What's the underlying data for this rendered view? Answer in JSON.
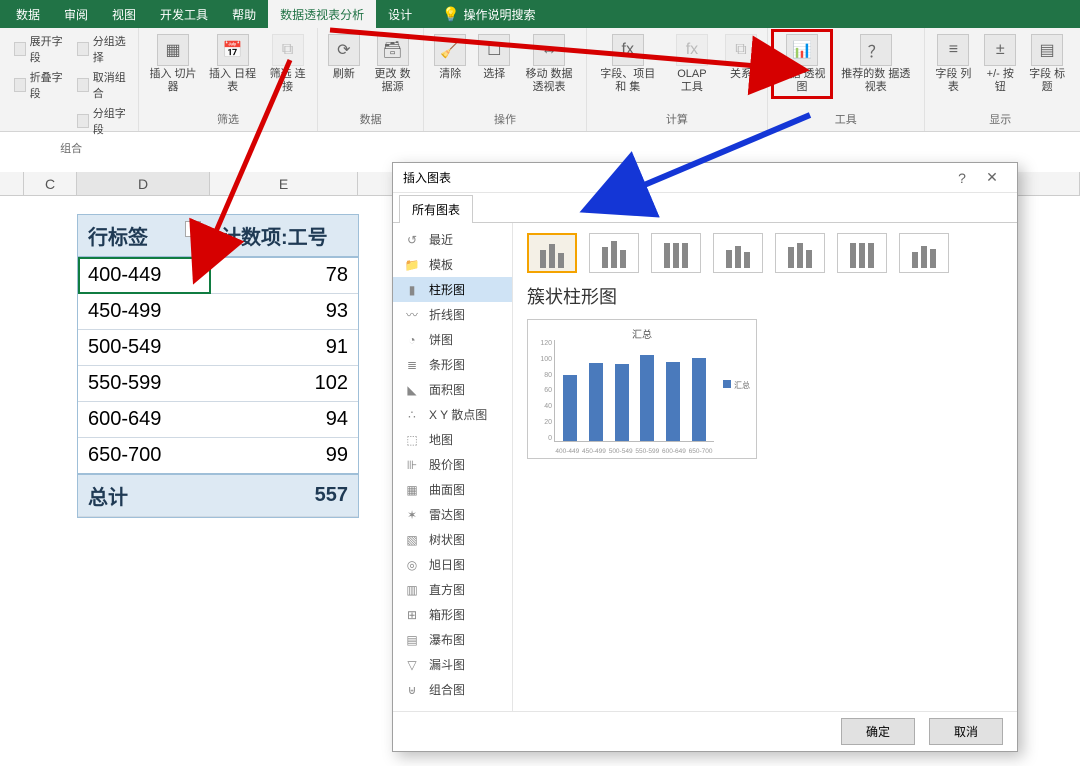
{
  "tabs": {
    "items": [
      "数据",
      "审阅",
      "视图",
      "开发工具",
      "帮助",
      "数据透视表分析",
      "设计"
    ],
    "active_index": 5,
    "tell_me": "操作说明搜索"
  },
  "ribbon": {
    "groups": [
      {
        "label": "组合",
        "small": [
          "分组选择",
          "取消组合",
          "分组字段"
        ],
        "left_small": [
          "展开字段",
          "折叠字段"
        ]
      },
      {
        "label": "筛选",
        "big": [
          {
            "label": "插入\n切片器"
          },
          {
            "label": "插入\n日程表"
          },
          {
            "label": "筛选\n连接",
            "disabled": true
          }
        ]
      },
      {
        "label": "数据",
        "big": [
          {
            "label": "刷新"
          },
          {
            "label": "更改\n数据源"
          }
        ]
      },
      {
        "label": "操作",
        "big": [
          {
            "label": "清除"
          },
          {
            "label": "选择"
          },
          {
            "label": "移动\n数据透视表"
          }
        ]
      },
      {
        "label": "计算",
        "big": [
          {
            "label": "字段、项目和\n集"
          },
          {
            "label": "OLAP 工具",
            "disabled": true
          },
          {
            "label": "关系",
            "disabled": true
          }
        ]
      },
      {
        "label": "工具",
        "big": [
          {
            "label": "数据\n透视图",
            "highlight": true
          },
          {
            "label": "推荐的数\n据透视表"
          }
        ]
      },
      {
        "label": "显示",
        "big": [
          {
            "label": "字段\n列表"
          },
          {
            "label": "+/- 按钮"
          },
          {
            "label": "字段\n标题"
          }
        ]
      }
    ]
  },
  "columns": [
    "C",
    "D",
    "E"
  ],
  "pivot": {
    "row_label": "行标签",
    "value_label": "计数项:工号",
    "rows": [
      {
        "label": "400-449",
        "value": 78
      },
      {
        "label": "450-499",
        "value": 93
      },
      {
        "label": "500-549",
        "value": 91
      },
      {
        "label": "550-599",
        "value": 102
      },
      {
        "label": "600-649",
        "value": 94
      },
      {
        "label": "650-700",
        "value": 99
      }
    ],
    "total_label": "总计",
    "total_value": 557,
    "selected_row_index": 0
  },
  "dialog": {
    "title": "插入图表",
    "tab": "所有图表",
    "chart_types": [
      {
        "label": "最近",
        "icon": "↺"
      },
      {
        "label": "模板",
        "icon": "📁"
      },
      {
        "label": "柱形图",
        "icon": "▮",
        "active": true
      },
      {
        "label": "折线图",
        "icon": "〰"
      },
      {
        "label": "饼图",
        "icon": "◔"
      },
      {
        "label": "条形图",
        "icon": "≣"
      },
      {
        "label": "面积图",
        "icon": "◣"
      },
      {
        "label": "X Y 散点图",
        "icon": "∴"
      },
      {
        "label": "地图",
        "icon": "⬚"
      },
      {
        "label": "股价图",
        "icon": "⊪"
      },
      {
        "label": "曲面图",
        "icon": "▦"
      },
      {
        "label": "雷达图",
        "icon": "✶"
      },
      {
        "label": "树状图",
        "icon": "▧"
      },
      {
        "label": "旭日图",
        "icon": "◎"
      },
      {
        "label": "直方图",
        "icon": "▥"
      },
      {
        "label": "箱形图",
        "icon": "⊞"
      },
      {
        "label": "瀑布图",
        "icon": "▤"
      },
      {
        "label": "漏斗图",
        "icon": "▽"
      },
      {
        "label": "组合图",
        "icon": "⊎"
      }
    ],
    "subtype_title": "簇状柱形图",
    "preview_title": "汇总",
    "preview_legend": "汇总",
    "buttons": {
      "ok": "确定",
      "cancel": "取消"
    }
  },
  "chart_data": {
    "type": "bar",
    "title": "汇总",
    "categories": [
      "400-449",
      "450-499",
      "500-549",
      "550-599",
      "600-649",
      "650-700"
    ],
    "values": [
      78,
      93,
      91,
      102,
      94,
      99
    ],
    "ylim": [
      0,
      120
    ],
    "y_ticks": [
      0,
      20,
      40,
      60,
      80,
      100,
      120
    ],
    "series_name": "汇总"
  }
}
